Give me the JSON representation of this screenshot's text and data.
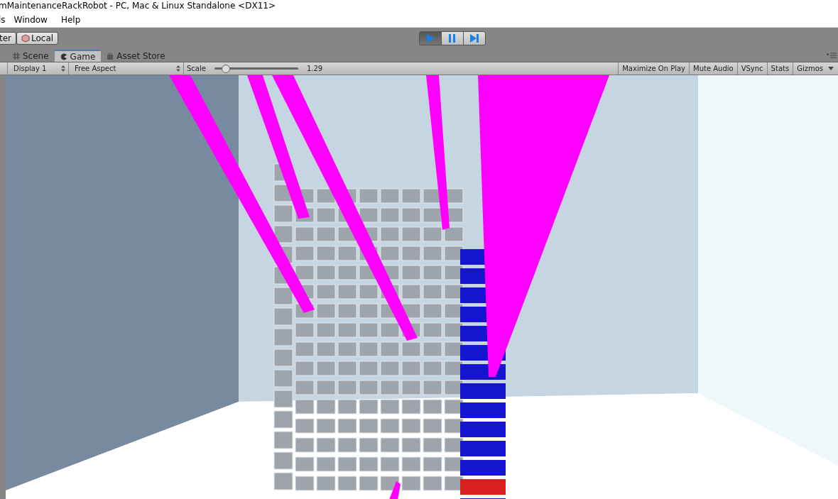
{
  "window": {
    "title": "mMaintenanceRackRobot - PC, Mac & Linux Standalone <DX11>"
  },
  "menu": [
    "ls",
    "Window",
    "Help"
  ],
  "toolbar": {
    "left_buttons": [
      {
        "label": "ter",
        "kind": "plain"
      },
      {
        "label": "Local",
        "kind": "cube"
      }
    ],
    "play_controls": [
      {
        "kind": "play",
        "selected": true
      },
      {
        "kind": "pause",
        "selected": false
      },
      {
        "kind": "step",
        "selected": false
      }
    ]
  },
  "tabs": [
    {
      "label": "Scene",
      "kind": "scene",
      "selected": false
    },
    {
      "label": "Game",
      "kind": "game",
      "selected": true
    },
    {
      "label": "Asset Store",
      "kind": "store",
      "selected": false
    }
  ],
  "game_toolbar": {
    "display": "Display 1",
    "aspect": "Free Aspect",
    "scale_label": "Scale",
    "scale": {
      "level": 0.12
    },
    "scale_value": "1.29",
    "toggles": [
      "Maximize On Play",
      "Mute Audio",
      "VSync",
      "Stats",
      "Gizmos"
    ]
  }
}
